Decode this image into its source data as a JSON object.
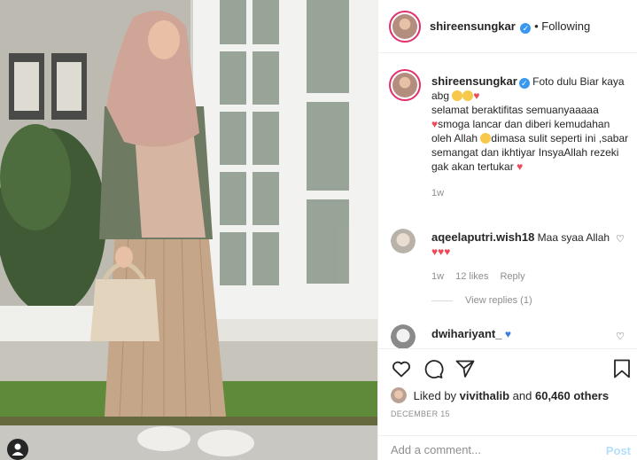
{
  "post": {
    "username": "shireensungkar",
    "verified_icon": "verified-badge-icon",
    "follow_separator": "•",
    "follow_status": "Following",
    "photo_alt": "Woman in pink hijab and olive jacket holding a handbag in front of a white window",
    "tag_icon": "user-tag-icon"
  },
  "caption": {
    "username": "shireensungkar",
    "line1": "Foto dulu Biar kaya abg",
    "line2": "selamat beraktifitas semuanyaaaaa",
    "line3": "smoga lancar dan diberi kemudahan oleh Allah",
    "line4": "dimasa sulit seperti ini ,sabar semangat dan ikhtiyar InsyaAllah rezeki gak akan tertukar",
    "age": "1w"
  },
  "comments": [
    {
      "username": "aqeelaputri.wish18",
      "text": "Maa syaa Allah",
      "age": "1w",
      "likes": "12 likes",
      "reply": "Reply",
      "view_replies": "View replies (1)"
    },
    {
      "username": "dwihariyant_",
      "text": ""
    }
  ],
  "actions": {
    "like_icon": "heart-icon",
    "comment_icon": "comment-icon",
    "share_icon": "paper-plane-icon",
    "save_icon": "bookmark-icon",
    "liked_by_prefix": "Liked by",
    "liked_by_user": "vivithalib",
    "liked_by_and": "and",
    "liked_by_others": "60,460 others",
    "date": "DECEMBER 15"
  },
  "add_comment": {
    "placeholder": "Add a comment...",
    "post_label": "Post"
  },
  "colors": {
    "accent": "#3897f0",
    "heart": "#ed4956",
    "muted": "#8e8e8e",
    "story_ring": "#e1306c",
    "post_disabled": "#b2dffc"
  }
}
